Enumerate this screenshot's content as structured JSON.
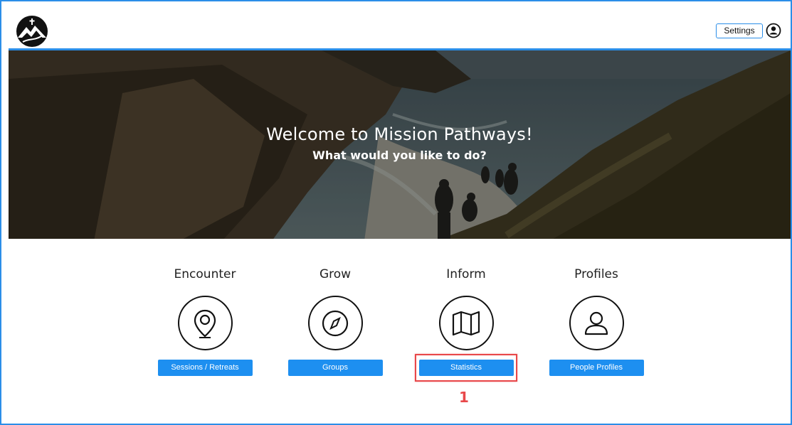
{
  "header": {
    "settings_label": "Settings",
    "logo_icon": "mountain-cross-logo-icon",
    "account_icon": "account-circle-icon"
  },
  "hero": {
    "title": "Welcome to Mission Pathways!",
    "subtitle": "What would you like to do?"
  },
  "cards": [
    {
      "title": "Encounter",
      "icon": "map-pin-icon",
      "button": "Sessions / Retreats"
    },
    {
      "title": "Grow",
      "icon": "compass-icon",
      "button": "Groups"
    },
    {
      "title": "Inform",
      "icon": "map-icon",
      "button": "Statistics"
    },
    {
      "title": "Profiles",
      "icon": "person-icon",
      "button": "People Profiles"
    }
  ],
  "annotation": {
    "step": "1"
  },
  "colors": {
    "accent": "#1d8ff0",
    "frame": "#2b8ee8",
    "highlight": "#e8484a"
  }
}
